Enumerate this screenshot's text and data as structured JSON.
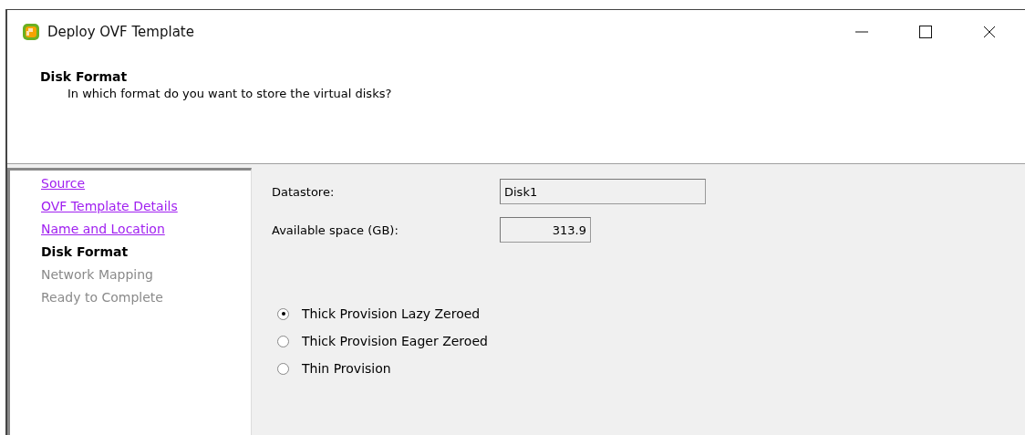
{
  "window": {
    "title": "Deploy OVF Template"
  },
  "header": {
    "title": "Disk Format",
    "subtitle": "In which format do you want to store the virtual disks?"
  },
  "steps": [
    {
      "label": "Source",
      "kind": "visited"
    },
    {
      "label": "OVF Template Details",
      "kind": "visited"
    },
    {
      "label": "Name and Location",
      "kind": "visited"
    },
    {
      "label": "Disk Format",
      "kind": "current"
    },
    {
      "label": "Network Mapping",
      "kind": "pending"
    },
    {
      "label": "Ready to Complete",
      "kind": "pending"
    }
  ],
  "fields": [
    {
      "label": "Datastore:",
      "value": "Disk1",
      "kind": "text"
    },
    {
      "label": "Available space (GB):",
      "value": "313.9",
      "kind": "number"
    }
  ],
  "formats": [
    {
      "label": "Thick Provision Lazy Zeroed",
      "selected": true
    },
    {
      "label": "Thick Provision Eager Zeroed",
      "selected": false
    },
    {
      "label": "Thin Provision",
      "selected": false
    }
  ]
}
